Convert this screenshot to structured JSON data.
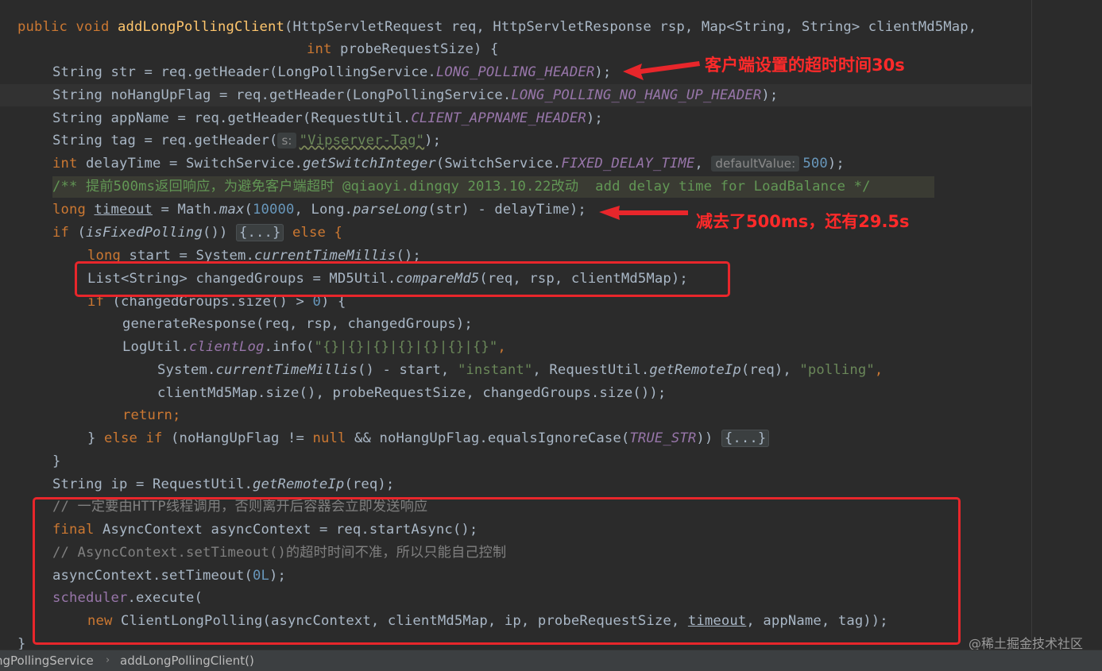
{
  "code": {
    "l1": {
      "a": "public",
      "b": "void",
      "c": "addLongPollingClient",
      "d": "(HttpServletRequest req, HttpServletResponse rsp, Map<String, String> clientMd5Map,"
    },
    "l2": {
      "a": "int",
      "b": " probeRequestSize) {"
    },
    "l3": {
      "a": "String str = req.getHeader(LongPollingService.",
      "b": "LONG_POLLING_HEADER",
      "c": ");"
    },
    "l4": {
      "a": "String noHangUpFlag = req.getHeader(LongPollingService.",
      "b": "LONG_POLLING_NO_HANG_UP_HEADER",
      "c": ");"
    },
    "l5": {
      "a": "String appName = req.getHeader(RequestUtil.",
      "b": "CLIENT_APPNAME_HEADER",
      "c": ");"
    },
    "l6": {
      "a": "String tag = req.getHeader(",
      "hint": "s:",
      "b": "\"Vipserver-Tag\"",
      "c": ");"
    },
    "l7": {
      "a": "int",
      "b": " delayTime = SwitchService.",
      "c": "getSwitchInteger",
      "d": "(SwitchService.",
      "e": "FIXED_DELAY_TIME",
      "f": ", ",
      "hint": "defaultValue:",
      "g": "500",
      "h": ");"
    },
    "l8": {
      "a": "/** 提前500ms返回响应，为避免客户端超时 @qiaoyi.dingqy 2013.10.22改动  add delay time for LoadBalance */"
    },
    "l9": {
      "a": "long",
      "b": "timeout",
      "c": " = Math.",
      "d": "max",
      "e": "(",
      "f": "10000",
      "g": ", Long.",
      "h": "parseLong",
      "i": "(str) - delayTime);"
    },
    "l10": {
      "a": "if",
      "b": " (",
      "c": "isFixedPolling",
      "d": "()) ",
      "fold": "{...}",
      "e": " else {"
    },
    "l11": {
      "a": "long",
      "b": " start = System.",
      "c": "currentTimeMillis",
      "d": "();"
    },
    "l12": {
      "a": "List<String> changedGroups = MD5Util.",
      "b": "compareMd5",
      "c": "(req, rsp, clientMd5Map);"
    },
    "l13": {
      "a": "if",
      "b": " (changedGroups.size() > ",
      "c": "0",
      "d": ") {"
    },
    "l14": {
      "a": "generateResponse(req, rsp, changedGroups);"
    },
    "l15": {
      "a": "LogUtil.",
      "b": "clientLog",
      "c": ".info(",
      "d": "\"{}|{}|{}|{}|{}|{}|{}\"",
      "e": ","
    },
    "l16": {
      "a": "System.",
      "b": "currentTimeMillis",
      "c": "() - start, ",
      "d": "\"instant\"",
      "e": ", RequestUtil.",
      "f": "getRemoteIp",
      "g": "(req), ",
      "h": "\"polling\"",
      "i": ","
    },
    "l17": {
      "a": "clientMd5Map.size(), probeRequestSize, changedGroups.size());"
    },
    "l18": {
      "a": "return",
      "b": ";"
    },
    "l19": {
      "a": "} ",
      "b": "else if",
      "c": " (noHangUpFlag != ",
      "d": "null",
      "e": " && noHangUpFlag.equalsIgnoreCase(",
      "f": "TRUE_STR",
      "g": ")) ",
      "fold": "{...}"
    },
    "l20": {
      "a": "}"
    },
    "l21": {
      "a": "String ip = RequestUtil.",
      "b": "getRemoteIp",
      "c": "(req);"
    },
    "l22": {
      "a": "// 一定要由HTTP线程调用，否则离开后容器会立即发送响应"
    },
    "l23": {
      "a": "final",
      "b": " AsyncContext asyncContext = req.startAsync();"
    },
    "l24": {
      "a": "// AsyncContext.setTimeout()的超时时间不准，所以只能自己控制"
    },
    "l25": {
      "a": "asyncContext.setTimeout(",
      "b": "0L",
      "c": ");"
    },
    "l26": {
      "a": "scheduler",
      "b": ".execute("
    },
    "l27": {
      "a": "new",
      "b": " ClientLongPolling(asyncContext, clientMd5Map, ip, probeRequestSize, ",
      "c": "timeout",
      "d": ", appName, tag));"
    },
    "l28": {
      "a": "}"
    }
  },
  "annotations": {
    "top": "客户端设置的超时时间30s",
    "middle": "减去了500ms，还有29.5s"
  },
  "statusbar": {
    "crumb1": "ngPollingService",
    "crumb2": "addLongPollingClient()"
  },
  "watermark": "@稀土掘金技术社区",
  "colors": {
    "background": "#2b2b2b",
    "keyword": "#cc7832",
    "method": "#ffc66d",
    "field": "#9876aa",
    "string": "#6a8759",
    "number": "#6897bb",
    "comment": "#808080",
    "annotation": "#e8262b"
  }
}
